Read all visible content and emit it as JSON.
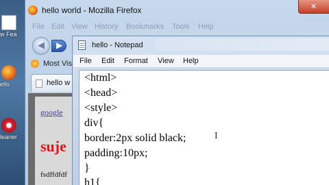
{
  "desktop": {
    "icons": [
      {
        "label": "w Fea"
      },
      {
        "label": "ello"
      },
      {
        "label": "leaner"
      }
    ]
  },
  "firefox": {
    "title": "hello world - Mozilla Firefox",
    "menu": [
      "File",
      "Edit",
      "View",
      "History",
      "Bookmarks",
      "Tools",
      "Help"
    ],
    "bookmark_label": "Most Visi",
    "tab_label": "hello w",
    "page": {
      "link": "google",
      "heading": "suje",
      "text": "fsdffdfdf"
    }
  },
  "notepad": {
    "title": "hello - Notepad",
    "menu": [
      "File",
      "Edit",
      "Format",
      "View",
      "Help"
    ],
    "lines": [
      "<html>",
      "<head>",
      "<style>",
      "div{",
      "border:2px solid black;",
      "padding:10px;",
      "}",
      "h1{"
    ]
  }
}
